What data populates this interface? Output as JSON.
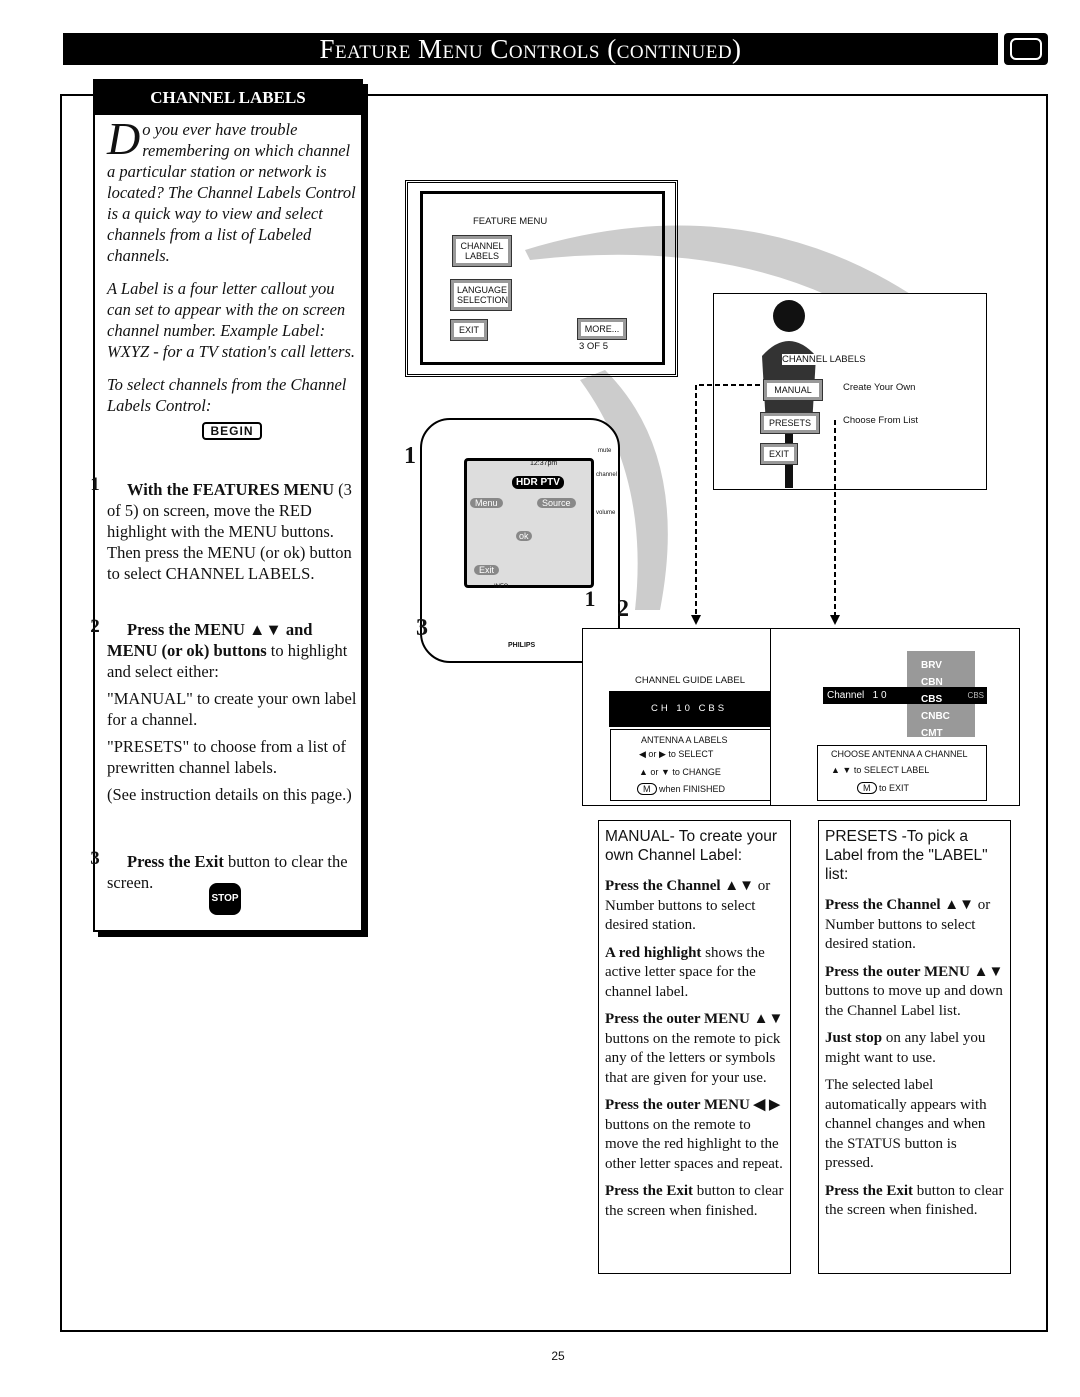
{
  "header": {
    "title": "Feature Menu Controls (continued)"
  },
  "section": {
    "title": "CHANNEL LABELS",
    "intro_dropcap": "D",
    "intro": "o you ever have trouble remembering on which channel a particular station or network is located? The Channel Labels Control is a quick way to view and select channels from a list of Labeled channels.",
    "label_def": "A Label is a four letter callout you can set to appear with the on screen channel number. Example Label: WXYZ - for a TV station's call letters.",
    "to_select": "To select channels from the Channel Labels Control:",
    "begin": "BEGIN",
    "steps": [
      {
        "num": "1",
        "bold": "With the FEATURES MENU",
        "text": "(3 of 5) on screen, move the RED highlight with the MENU buttons. Then press the MENU (or ok) button to select CHANNEL LABELS."
      },
      {
        "num": "2",
        "bold": "Press the MENU ▲▼ and MENU (or ok) buttons",
        "text": "to highlight and select either:",
        "sub": [
          "\"MANUAL\" to create your own label for a channel.",
          "\"PRESETS\" to choose from a list of prewritten channel labels.",
          "(See instruction details on this page.)"
        ]
      },
      {
        "num": "3",
        "bold": "Press the Exit",
        "text": "button to clear the screen."
      }
    ],
    "stop": "STOP"
  },
  "feature_menu": {
    "title": "FEATURE MENU",
    "channel_labels": "CHANNEL LABELS",
    "language": "LANGUAGE SELECTION",
    "exit": "EXIT",
    "more": "MORE...",
    "page": "3 OF 5"
  },
  "channel_labels_menu": {
    "title": "CHANNEL LABELS",
    "manual": "MANUAL",
    "manual_desc": "Create Your Own",
    "presets": "PRESETS",
    "presets_desc": "Choose From List",
    "exit": "EXIT"
  },
  "remote": {
    "time": "12:37pm",
    "display": "HDR PTV",
    "menu": "Menu",
    "source": "Source",
    "ok": "ok",
    "exit": "Exit",
    "info": "INFO",
    "mute": "mute",
    "channel": "channel",
    "volume": "volume",
    "brand": "PHILIPS",
    "callouts": [
      "1",
      "2",
      "3",
      "1"
    ]
  },
  "manual_screen": {
    "title": "CHANNEL GUIDE LABEL",
    "entry": "CH 10 CBS",
    "antenna": "ANTENNA A LABELS",
    "or": "or",
    "select": "to SELECT",
    "change": "to CHANGE",
    "m": "M",
    "finished": "when FINISHED"
  },
  "presets_screen": {
    "labels": [
      "BRV",
      "CBN",
      "CBS",
      "CNBC",
      "CMT"
    ],
    "selected": "CBS",
    "channel": "Channel",
    "channel_num": "1 0",
    "choose": "CHOOSE ANTENNA A CHANNEL",
    "select_label": "to SELECT LABEL",
    "m": "M",
    "exit": "to EXIT"
  },
  "manual_col": {
    "heading": "MANUAL- To create your own Channel Label:",
    "paras": [
      [
        "Press the Channel ▲▼",
        " or Number buttons to select desired station."
      ],
      [
        "A red highlight",
        " shows the active letter space for the channel label."
      ],
      [
        "Press the outer MENU",
        " ▲▼ buttons on the remote to pick any of the letters or symbols that are given for your use."
      ],
      [
        "Press the outer MENU ◀",
        " ▶ buttons on the remote to move the red highlight to the other letter spaces and repeat."
      ],
      [
        "Press the Exit",
        " button to clear the screen when finished."
      ]
    ]
  },
  "presets_col": {
    "heading": "PRESETS -To pick a Label from the \"LABEL\" list:",
    "paras": [
      [
        "Press the Channel ▲▼",
        " or Number buttons to select desired station."
      ],
      [
        "Press the outer MENU",
        " ▲▼ buttons to move up and down the Channel Label list."
      ],
      [
        "Just stop",
        " on any label you might want to use."
      ],
      [
        "",
        "The selected label automatically appears with channel changes and when the STATUS button is pressed."
      ],
      [
        "Press the Exit",
        " button to clear the screen when finished."
      ]
    ]
  },
  "page_number": "25"
}
